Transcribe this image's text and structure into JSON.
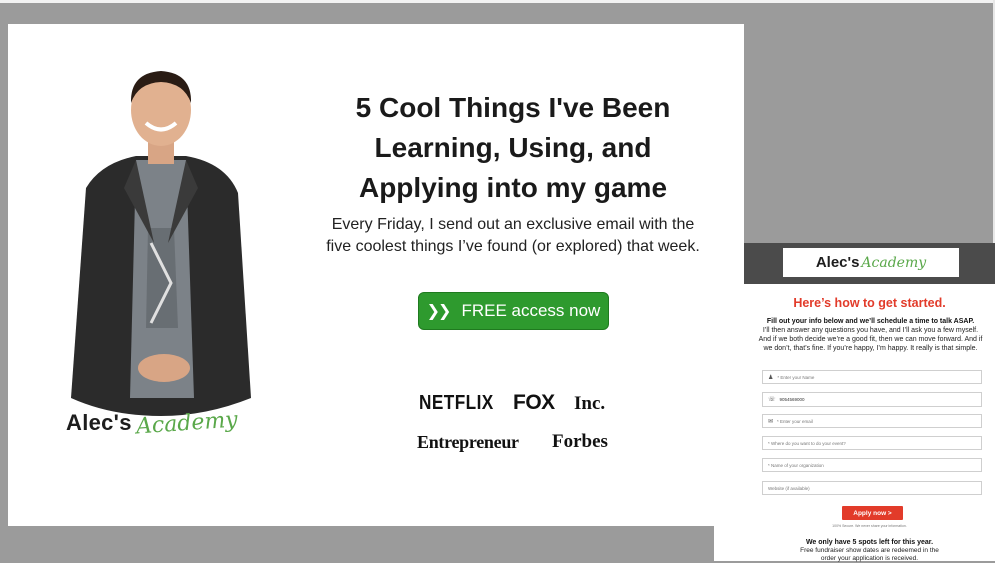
{
  "popup": {
    "headline": "5 Cool Things I've Been Learning, Using, and Applying into my game",
    "subtext": "Every Friday, I send out an exclusive email with the five coolest things I’ve found (or explored) that week.",
    "cta_label": "FREE access now",
    "brand": {
      "part1": "Alec's",
      "part2": "Academy"
    },
    "press_logos": [
      "NETFLIX",
      "FOX",
      "Inc.",
      "Entrepreneur",
      "Forbes"
    ]
  },
  "signup": {
    "brand": {
      "part1": "Alec's",
      "part2": "Academy"
    },
    "title": "Here’s how to get started.",
    "intro_bold": "Fill out your info below and we’ll schedule a time to talk ASAP.",
    "intro_body": "I’ll then answer any questions you have, and I’ll ask you a few myself. And if we both decide we’re a good fit, then we can move forward. And if we don’t, that’s fine. If you’re happy, I’m happy. It really is that simple.",
    "fields": {
      "name_placeholder": "* Enter your Name",
      "phone_value": "9054569000",
      "email_placeholder": "* Enter your email",
      "event_placeholder": "* Where do you want to do your event?",
      "org_placeholder": "* Name of your organization",
      "website_placeholder": "Website (if available)"
    },
    "apply_label": "Apply now >",
    "privacy_note": "100% Secure. We never share your information.",
    "spots_title": "We only have 5 spots left for this year.",
    "spots_body": "Free fundraiser show dates are redeemed in the order your application is received."
  },
  "colors": {
    "cta_green": "#2e9a2e",
    "accent_red": "#e23b2a",
    "brand_green": "#5aa84a"
  }
}
